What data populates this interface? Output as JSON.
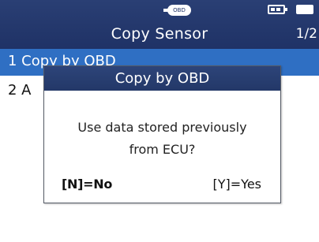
{
  "header": {
    "status_icons": {
      "obd": {
        "icon": "obd-connector-icon",
        "label": "OBD"
      },
      "battery": "battery-icon",
      "power": "power-icon"
    },
    "title": "Copy Sensor",
    "page_indicator": "1/2"
  },
  "menu": {
    "items": [
      {
        "label": "1 Copy by OBD",
        "selected": true
      },
      {
        "label": "2 A",
        "selected": false
      }
    ]
  },
  "dialog": {
    "title": "Copy by OBD",
    "message": "Use data stored previously\nfrom ECU?",
    "no_label": "[N]=No",
    "yes_label": "[Y]=Yes"
  },
  "colors": {
    "header_bg": "#1f3266",
    "selected_row": "#2f6fc3",
    "dialog_header": "#233868"
  }
}
